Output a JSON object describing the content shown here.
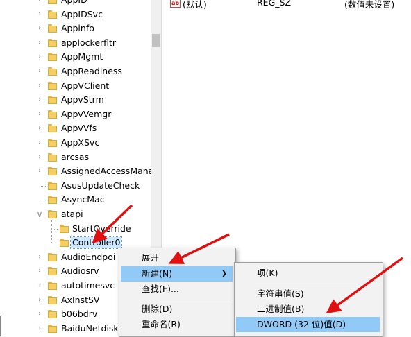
{
  "tree": {
    "items": [
      {
        "label": "AppID",
        "level": 0
      },
      {
        "label": "AppIDSvc",
        "level": 0
      },
      {
        "label": "Appinfo",
        "level": 0
      },
      {
        "label": "applockerfltr",
        "level": 0
      },
      {
        "label": "AppMgmt",
        "level": 0
      },
      {
        "label": "AppReadiness",
        "level": 0
      },
      {
        "label": "AppVClient",
        "level": 0
      },
      {
        "label": "AppvStrm",
        "level": 0
      },
      {
        "label": "AppvVemgr",
        "level": 0
      },
      {
        "label": "AppvVfs",
        "level": 0
      },
      {
        "label": "AppXSvc",
        "level": 0
      },
      {
        "label": "arcsas",
        "level": 0
      },
      {
        "label": "AssignedAccessMana",
        "level": 0
      },
      {
        "label": "AsusUpdateCheck",
        "level": 0
      },
      {
        "label": "AsyncMac",
        "level": 0
      },
      {
        "label": "atapi",
        "level": 0,
        "expanded": true
      },
      {
        "label": "StartOverride",
        "level": 1
      },
      {
        "label": "Controller0",
        "level": 1,
        "selected": true
      },
      {
        "label": "AudioEndpoi",
        "level": 0
      },
      {
        "label": "Audiosrv",
        "level": 0
      },
      {
        "label": "autotimesvc",
        "level": 0
      },
      {
        "label": "AxInstSV",
        "level": 0
      },
      {
        "label": "b06bdrv",
        "level": 0
      },
      {
        "label": "BaiduNetdisk",
        "level": 0
      }
    ]
  },
  "values": {
    "rows": [
      {
        "icon": "ab",
        "name": "(默认)",
        "type": "REG_SZ",
        "data": "(数值未设置)"
      }
    ]
  },
  "context_menu": {
    "items": [
      {
        "label": "展开"
      },
      {
        "label": "新建(N)",
        "has_submenu": true,
        "highlighted": true
      },
      {
        "label": "查找(F)..."
      },
      {
        "label": "删除(D)"
      },
      {
        "label": "重命名(R)"
      }
    ]
  },
  "submenu": {
    "items": [
      {
        "label": "项(K)"
      },
      {
        "label": "字符串值(S)"
      },
      {
        "label": "二进制值(B)"
      },
      {
        "label": "DWORD (32 位)值(D)",
        "highlighted": true
      }
    ]
  },
  "colors": {
    "highlight": "#91c9f7",
    "annotation_arrow": "#e01010",
    "folder": "#f5cf63"
  }
}
